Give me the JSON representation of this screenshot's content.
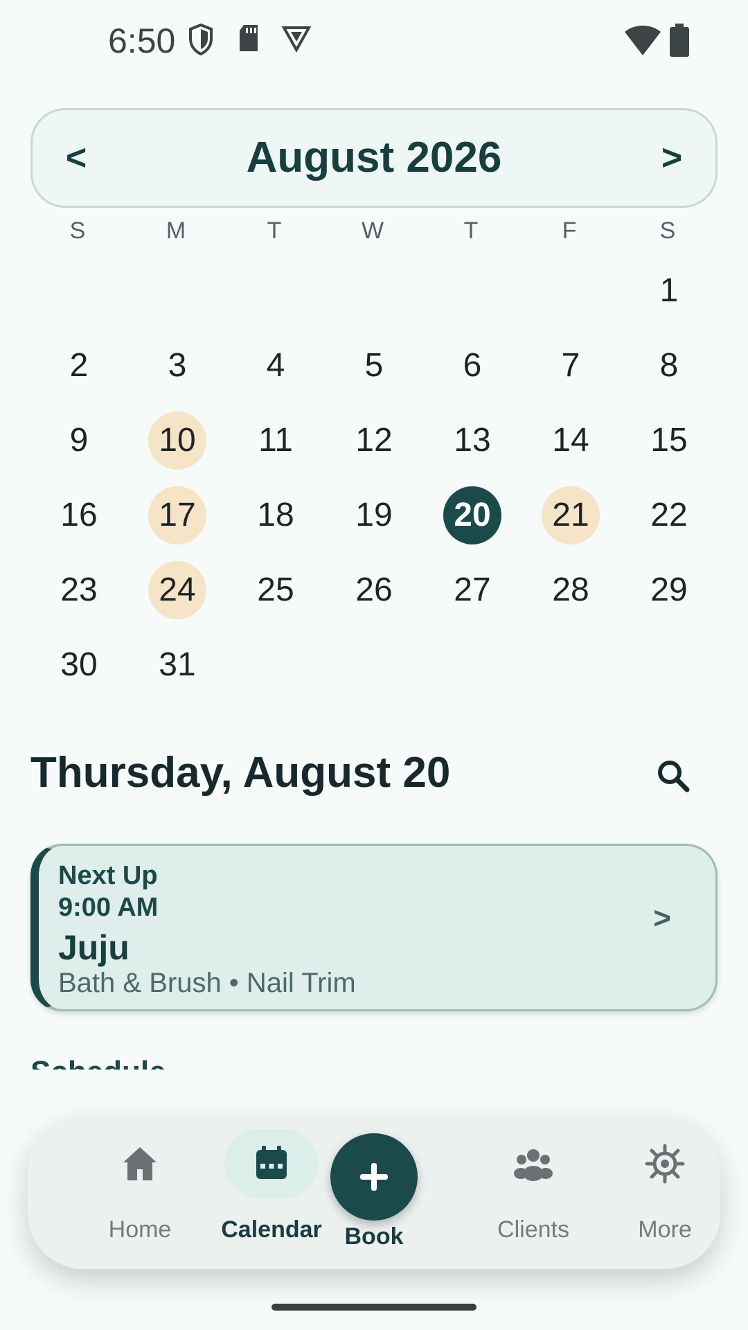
{
  "status_bar": {
    "time": "6:50",
    "icons": [
      "shield-icon",
      "sd-card-icon",
      "vpn-icon",
      "wifi-icon",
      "battery-icon"
    ]
  },
  "calendar": {
    "month_title": "August 2026",
    "prev_label": "<",
    "next_label": ">",
    "weekdays": [
      "S",
      "M",
      "T",
      "W",
      "T",
      "F",
      "S"
    ],
    "weeks": [
      [
        "",
        "",
        "",
        "",
        "",
        "",
        "1"
      ],
      [
        "2",
        "3",
        "4",
        "5",
        "6",
        "7",
        "8"
      ],
      [
        "9",
        "10",
        "11",
        "12",
        "13",
        "14",
        "15"
      ],
      [
        "16",
        "17",
        "18",
        "19",
        "20",
        "21",
        "22"
      ],
      [
        "23",
        "24",
        "25",
        "26",
        "27",
        "28",
        "29"
      ],
      [
        "30",
        "31",
        "",
        "",
        "",
        "",
        ""
      ]
    ],
    "booked_days": [
      "10",
      "17",
      "21",
      "24"
    ],
    "selected_day": "20",
    "colors": {
      "booked": "#f6e4c6",
      "selected": "#1a4b4a"
    }
  },
  "day_view": {
    "heading": "Thursday, August 20",
    "next_up": {
      "label": "Next Up",
      "time": "9:00 AM",
      "name": "Juju",
      "service": "Bath & Brush • Nail Trim",
      "arrow": ">"
    },
    "schedule_heading": "Schedule"
  },
  "bottom_nav": {
    "items": [
      {
        "label": "Home",
        "icon": "home-icon"
      },
      {
        "label": "Calendar",
        "icon": "calendar-icon",
        "active": true
      },
      {
        "label": "Book",
        "icon": "plus-icon"
      },
      {
        "label": "Clients",
        "icon": "people-icon"
      },
      {
        "label": "More",
        "icon": "gear-icon"
      }
    ]
  },
  "theme": {
    "accent": "#1a4b4a",
    "background": "#f6faf9"
  }
}
